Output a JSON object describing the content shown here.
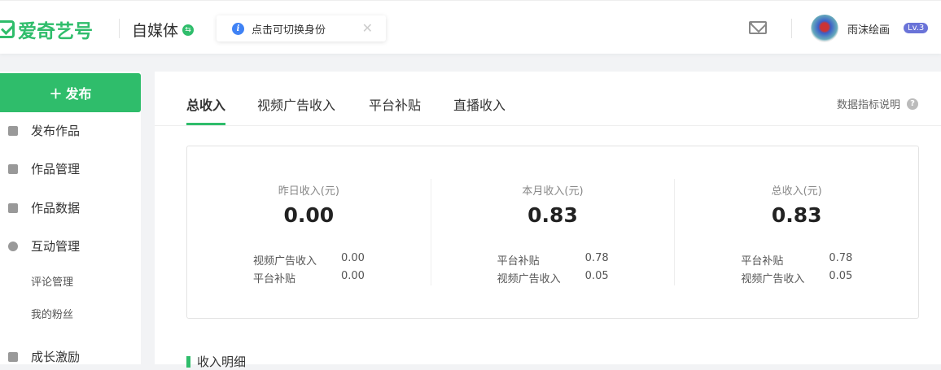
{
  "header": {
    "logo": "爱奇艺号",
    "identity": "自媒体",
    "tip": "点击可切换身份",
    "username": "雨沫绘画",
    "level": "Lv.3"
  },
  "sidebar": {
    "publish": "发布",
    "items": [
      "发布作品",
      "作品管理",
      "作品数据",
      "互动管理"
    ],
    "sub_items": [
      "评论管理",
      "我的粉丝"
    ],
    "more": "成长激励"
  },
  "tabs": [
    "总收入",
    "视频广告收入",
    "平台补贴",
    "直播收入"
  ],
  "help": "数据指标说明",
  "stats": [
    {
      "label": "昨日收入(元)",
      "value": "0.00",
      "rows": [
        [
          "视频广告收入",
          "0.00"
        ],
        [
          "平台补贴",
          "0.00"
        ]
      ]
    },
    {
      "label": "本月收入(元)",
      "value": "0.83",
      "rows": [
        [
          "平台补贴",
          "0.78"
        ],
        [
          "视频广告收入",
          "0.05"
        ]
      ]
    },
    {
      "label": "总收入(元)",
      "value": "0.83",
      "rows": [
        [
          "平台补贴",
          "0.78"
        ],
        [
          "视频广告收入",
          "0.05"
        ]
      ]
    }
  ],
  "section_title": "收入明细"
}
